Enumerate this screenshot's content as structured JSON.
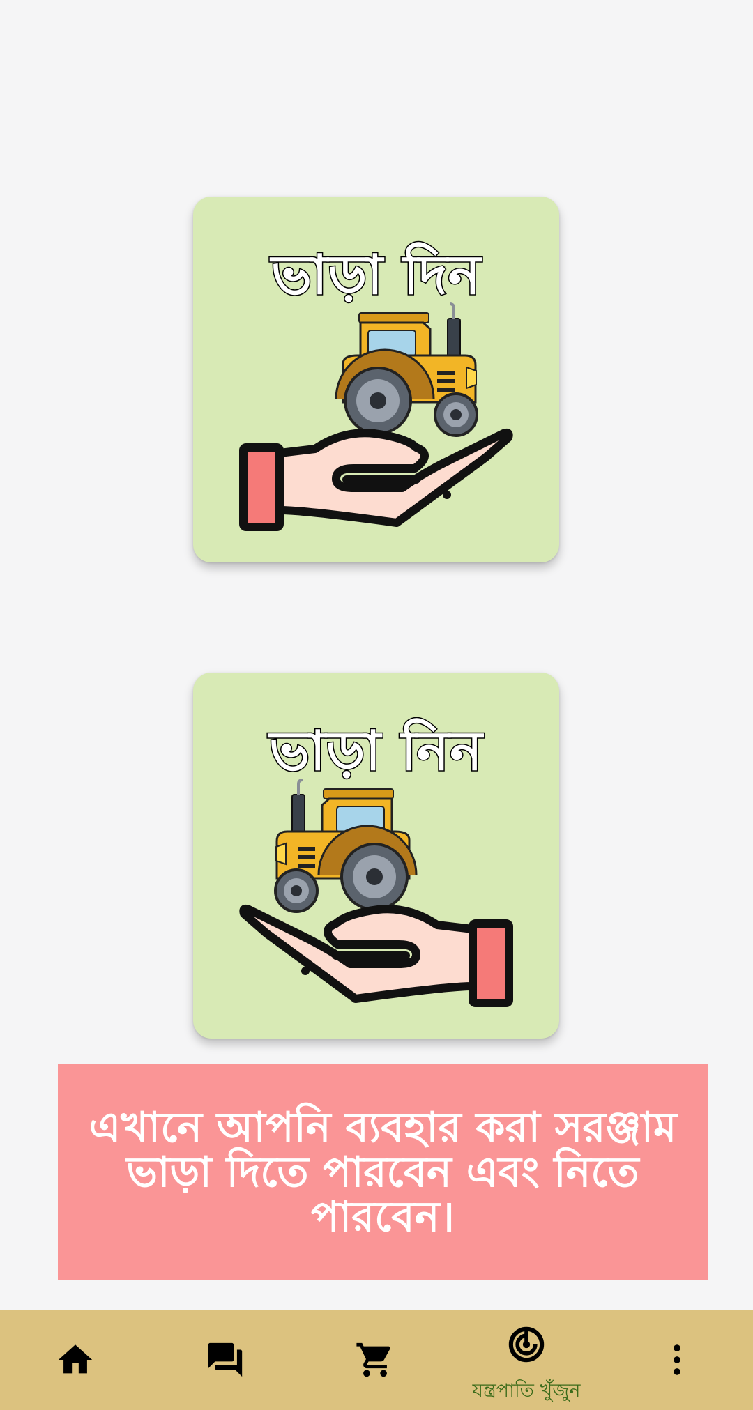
{
  "cards": [
    {
      "title": "ভাড়া দিন",
      "icon": "hand-giving-tractor-icon"
    },
    {
      "title": "ভাড়া নিন",
      "icon": "hand-receiving-tractor-icon"
    }
  ],
  "banner": {
    "text": "এখানে আপনি ব্যবহার করা সরঞ্জাম ভাড়া দিতে পারবেন এবং নিতে পারবেন।"
  },
  "bottom_nav": {
    "items": [
      {
        "icon": "home-icon",
        "label": ""
      },
      {
        "icon": "chat-icon",
        "label": ""
      },
      {
        "icon": "cart-icon",
        "label": ""
      },
      {
        "icon": "radar-icon",
        "label": "যন্ত্রপাতি খুঁজুন",
        "active": true
      },
      {
        "icon": "more-vert-icon",
        "label": ""
      }
    ]
  },
  "colors": {
    "background": "#f5f5f6",
    "card": "#d8eab5",
    "banner": "#fa9596",
    "bottom_nav": "#dcc27f",
    "active_label": "#3b6b1a"
  }
}
